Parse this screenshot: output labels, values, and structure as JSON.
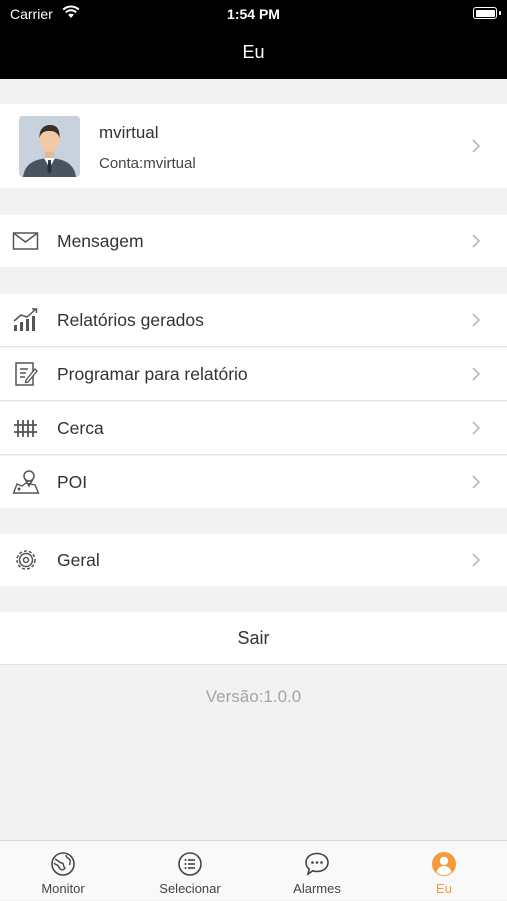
{
  "status_bar": {
    "carrier": "Carrier",
    "time": "1:54 PM"
  },
  "nav": {
    "title": "Eu"
  },
  "profile": {
    "name": "mvirtual",
    "account": "Conta:mvirtual"
  },
  "menu": {
    "message": "Mensagem",
    "reports": "Relatórios gerados",
    "schedule": "Programar para relatório",
    "fence": "Cerca",
    "poi": "POI",
    "general": "Geral"
  },
  "logout_label": "Sair",
  "version": "Versão:1.0.0",
  "tabs": [
    {
      "label": "Monitor",
      "icon": "globe-icon"
    },
    {
      "label": "Selecionar",
      "icon": "list-icon"
    },
    {
      "label": "Alarmes",
      "icon": "chat-icon"
    },
    {
      "label": "Eu",
      "icon": "person-icon",
      "active": true
    }
  ],
  "colors": {
    "accent": "#f49a3a",
    "header": "#000000",
    "background": "#f2f2f2"
  }
}
